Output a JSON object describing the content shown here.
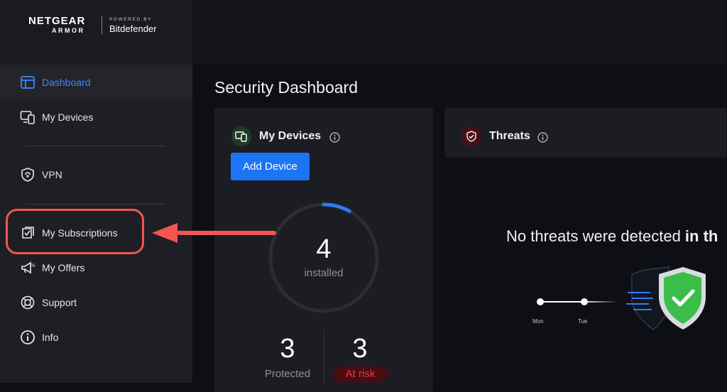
{
  "brand": {
    "netgear": "NETGEAR",
    "armor": "ARMOR",
    "powered_by": "POWERED BY",
    "bitdefender": "Bitdefender"
  },
  "sidebar": {
    "items": [
      {
        "label": "Dashboard",
        "icon": "dashboard-icon",
        "active": true
      },
      {
        "label": "My Devices",
        "icon": "devices-icon"
      },
      {
        "label": "VPN",
        "icon": "shield-lock-icon"
      },
      {
        "label": "My Subscriptions",
        "icon": "subscription-icon"
      },
      {
        "label": "My Offers",
        "icon": "megaphone-icon"
      },
      {
        "label": "Support",
        "icon": "lifebuoy-icon"
      },
      {
        "label": "Info",
        "icon": "info-icon"
      }
    ]
  },
  "main": {
    "title": "Security Dashboard",
    "devices_card": {
      "title": "My Devices",
      "add_button": "Add Device",
      "installed_count": "4",
      "installed_label": "installed",
      "protected_count": "3",
      "protected_label": "Protected",
      "at_risk_count": "3",
      "at_risk_label": "At risk",
      "ring_progress": 0.08
    },
    "threats_card": {
      "title": "Threats",
      "message_prefix": "No threats were detected ",
      "message_bold": "in th",
      "timeline_labels": [
        "Mon",
        "Tue"
      ]
    }
  },
  "colors": {
    "accent": "#1d74f5",
    "active_text": "#3a86ff",
    "risk": "#e23b4b",
    "annotation": "#f2564f",
    "shield_green": "#3cbd4a"
  }
}
